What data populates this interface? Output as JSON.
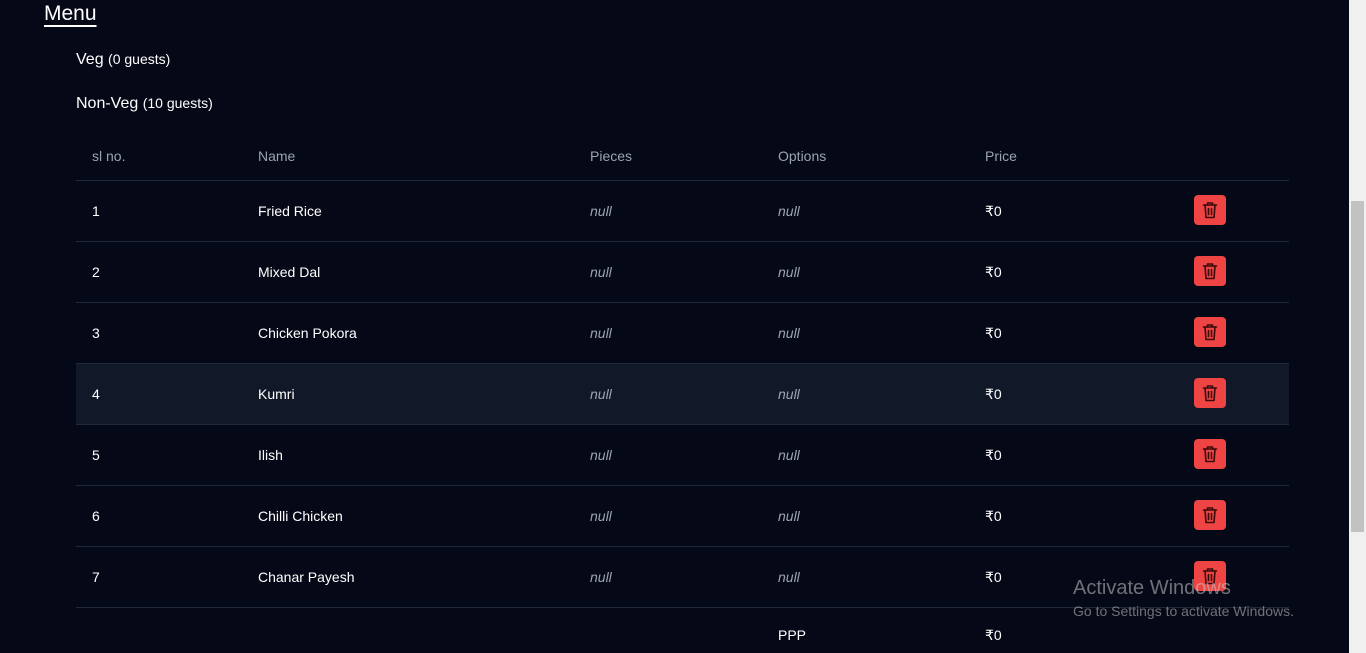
{
  "menu": {
    "title": "Menu"
  },
  "sections": {
    "veg": {
      "label": "Veg",
      "count": "(0 guests)"
    },
    "nonveg": {
      "label": "Non-Veg",
      "count": "(10 guests)"
    }
  },
  "table": {
    "headers": {
      "sl": "sl no.",
      "name": "Name",
      "pieces": "Pieces",
      "options": "Options",
      "price": "Price"
    },
    "rows": [
      {
        "sl": "1",
        "name": "Fried Rice",
        "pieces": "null",
        "options": "null",
        "price": "₹0"
      },
      {
        "sl": "2",
        "name": "Mixed Dal",
        "pieces": "null",
        "options": "null",
        "price": "₹0"
      },
      {
        "sl": "3",
        "name": "Chicken Pokora",
        "pieces": "null",
        "options": "null",
        "price": "₹0"
      },
      {
        "sl": "4",
        "name": "Kumri",
        "pieces": "null",
        "options": "null",
        "price": "₹0"
      },
      {
        "sl": "5",
        "name": "Ilish",
        "pieces": "null",
        "options": "null",
        "price": "₹0"
      },
      {
        "sl": "6",
        "name": "Chilli Chicken",
        "pieces": "null",
        "options": "null",
        "price": "₹0"
      },
      {
        "sl": "7",
        "name": "Chanar Payesh",
        "pieces": "null",
        "options": "null",
        "price": "₹0"
      }
    ],
    "footer": {
      "label": "PPP",
      "price": "₹0"
    }
  },
  "icons": {
    "delete": "trash-icon"
  },
  "colors": {
    "background": "#050816",
    "delete_button": "#ef4444",
    "highlight_row": "#111827"
  },
  "watermark": {
    "title": "Activate Windows",
    "subtitle": "Go to Settings to activate Windows."
  }
}
